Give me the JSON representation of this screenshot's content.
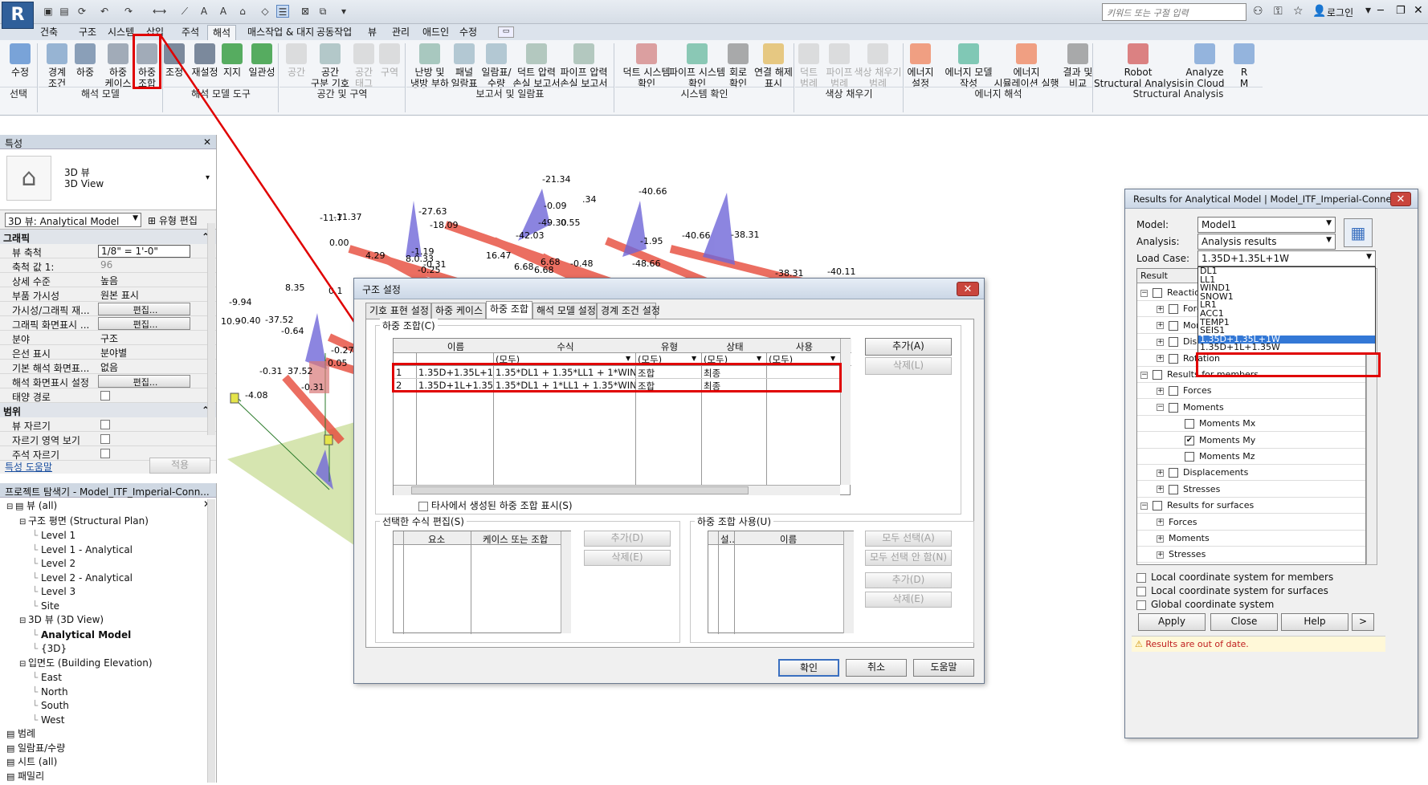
{
  "titlebar": {
    "logo": "R",
    "search_placeholder": "키워드 또는 구절 입력",
    "login": "로그인"
  },
  "ribbon_tabs": [
    "건축",
    "구조",
    "시스템",
    "삽입",
    "주석",
    "해석",
    "매스작업 & 대지",
    "공동작업",
    "뷰",
    "관리",
    "애드인",
    "수정"
  ],
  "active_tab": "해석",
  "ribbon": {
    "buttons": [
      {
        "label1": "수정",
        "label2": "",
        "icon": "modify-icon",
        "color": "#5a8ed0"
      },
      {
        "label1": "경계",
        "label2": "조건",
        "icon": "boundary-conditions-icon",
        "color": "#7fa4c9"
      },
      {
        "label1": "하중",
        "label2": "",
        "icon": "loads-icon",
        "color": "#6f8aa8"
      },
      {
        "label1": "하중",
        "label2": "케이스",
        "icon": "load-cases-icon",
        "color": "#8c98a8"
      },
      {
        "label1": "하중",
        "label2": "조합",
        "icon": "load-combinations-icon",
        "color": "#8c98a8"
      },
      {
        "label1": "조정",
        "label2": "",
        "icon": "adjust-icon",
        "color": "#5c6e84"
      },
      {
        "label1": "재설정",
        "label2": "",
        "icon": "reset-icon",
        "color": "#5c6e84"
      },
      {
        "label1": "지지",
        "label2": "",
        "icon": "supports-icon",
        "color": "#2e9a3a"
      },
      {
        "label1": "일관성",
        "label2": "",
        "icon": "consistency-icon",
        "color": "#2e9a3a"
      }
    ],
    "buttons2": [
      {
        "label1": "공간",
        "label2": "",
        "dis": true
      },
      {
        "label1": "공간",
        "label2": "구분 기호",
        "dis": false
      },
      {
        "label1": "공간",
        "label2": "태그",
        "dis": true
      },
      {
        "label1": "구역",
        "label2": "",
        "dis": true
      },
      {
        "label1": "난방 및",
        "label2": "냉방 부하",
        "dis": false
      },
      {
        "label1": "패널",
        "label2": "일람표",
        "dis": false
      },
      {
        "label1": "일람표/",
        "label2": "수량",
        "dis": false
      },
      {
        "label1": "덕트 압력",
        "label2": "손실 보고서",
        "dis": false
      },
      {
        "label1": "파이프 압력",
        "label2": "손실 보고서",
        "dis": false
      },
      {
        "label1": "덕트 시스템",
        "label2": "확인",
        "dis": false
      },
      {
        "label1": "파이프 시스템",
        "label2": "확인",
        "dis": false
      },
      {
        "label1": "회로",
        "label2": "확인",
        "dis": false
      },
      {
        "label1": "연결 해제",
        "label2": "표시",
        "dis": false
      },
      {
        "label1": "덕트",
        "label2": "범례",
        "dis": true
      },
      {
        "label1": "파이프",
        "label2": "범례",
        "dis": true
      },
      {
        "label1": "색상 채우기",
        "label2": "범례",
        "dis": true
      },
      {
        "label1": "에너지",
        "label2": "설정",
        "dis": false
      },
      {
        "label1": "에너지 모델",
        "label2": "작성",
        "dis": false
      },
      {
        "label1": "에너지",
        "label2": "시뮬레이션 실행",
        "dis": false
      },
      {
        "label1": "결과 및",
        "label2": "비교",
        "dis": false
      },
      {
        "label1": "Robot",
        "label2": "Structural Analysis",
        "dis": false
      },
      {
        "label1": "Analyze",
        "label2": "in Cloud",
        "dis": false
      },
      {
        "label1": "R",
        "label2": "M",
        "dis": false
      }
    ],
    "panels": [
      "선택",
      "해석 모델",
      "해석 모델 도구",
      "공간 및 구역",
      "보고서 및 일람표",
      "시스템 확인",
      "색상 채우기",
      "에너지 해석",
      "Structural Analysis"
    ]
  },
  "properties": {
    "header": "특성",
    "type_name1": "3D 뷰",
    "type_name2": "3D View",
    "instance_selector": "3D 뷰: Analytical Model",
    "edit_type": "유형 편집",
    "section_graphics": "그래픽",
    "rows": [
      {
        "k": "뷰 축척",
        "v": "1/8\" = 1'-0\"",
        "t": "inp"
      },
      {
        "k": "축척 값    1:",
        "v": "96",
        "t": "gray"
      },
      {
        "k": "상세 수준",
        "v": "높음",
        "t": "text"
      },
      {
        "k": "부품 가시성",
        "v": "원본 표시",
        "t": "text"
      },
      {
        "k": "가시성/그래픽 재...",
        "v": "편집...",
        "t": "btn"
      },
      {
        "k": "그래픽 화면표시 ...",
        "v": "편집...",
        "t": "btn"
      },
      {
        "k": "분야",
        "v": "구조",
        "t": "text"
      },
      {
        "k": "은선 표시",
        "v": "분야별",
        "t": "text"
      },
      {
        "k": "기본 해석 화면표...",
        "v": "없음",
        "t": "text"
      },
      {
        "k": "해석 화면표시 설정",
        "v": "편집...",
        "t": "btn"
      },
      {
        "k": "태양 경로",
        "v": "",
        "t": "chk"
      }
    ],
    "section_extents": "범위",
    "rows2": [
      {
        "k": "뷰 자르기",
        "v": "",
        "t": "chk"
      },
      {
        "k": "자르기 영역 보기",
        "v": "",
        "t": "chk"
      },
      {
        "k": "주석 자르기",
        "v": "",
        "t": "chk"
      }
    ],
    "help_link": "특성 도움말",
    "apply": "적용"
  },
  "browser": {
    "header": "프로젝트 탐색기 - Model_ITF_Imperial-Conn...",
    "items": [
      {
        "t": "뷰 (all)",
        "lvl": 0,
        "exp": "-",
        "icon": true
      },
      {
        "t": "구조 평면 (Structural Plan)",
        "lvl": 1,
        "exp": "-"
      },
      {
        "t": "Level 1",
        "lvl": 2
      },
      {
        "t": "Level 1 - Analytical",
        "lvl": 2
      },
      {
        "t": "Level 2",
        "lvl": 2
      },
      {
        "t": "Level 2 - Analytical",
        "lvl": 2
      },
      {
        "t": "Level 3",
        "lvl": 2
      },
      {
        "t": "Site",
        "lvl": 2
      },
      {
        "t": "3D 뷰 (3D View)",
        "lvl": 1,
        "exp": "-"
      },
      {
        "t": "Analytical Model",
        "lvl": 2,
        "bold": true
      },
      {
        "t": "{3D}",
        "lvl": 2
      },
      {
        "t": "입면도 (Building Elevation)",
        "lvl": 1,
        "exp": "-"
      },
      {
        "t": "East",
        "lvl": 2
      },
      {
        "t": "North",
        "lvl": 2
      },
      {
        "t": "South",
        "lvl": 2
      },
      {
        "t": "West",
        "lvl": 2
      },
      {
        "t": "범례",
        "lvl": 0,
        "icon": true
      },
      {
        "t": "일람표/수량",
        "lvl": 0,
        "icon": true
      },
      {
        "t": "시트 (all)",
        "lvl": 0,
        "icon": true
      },
      {
        "t": "패밀리",
        "lvl": 0,
        "icon": true
      }
    ]
  },
  "viewport_labels": [
    "-21.34",
    ".34",
    "-40.66",
    "-0.09",
    "-11.7",
    "-11.37",
    "-27.63",
    "-18.09",
    "-49.30",
    "0.55",
    "-40.66",
    "-38.31",
    "0.00",
    "-42.03",
    "-1.95",
    "4.29",
    "8.0.33",
    "-1.19",
    "16.47",
    "6.68",
    "-0.31",
    "-0.25",
    "6.68",
    "-0.48",
    "-48.66",
    "6.68",
    "8.35",
    "-38.31",
    "-40.11",
    "0.1",
    "-9.94",
    "-37.52",
    "10.9",
    "-0.40",
    "-0.64",
    "-0.27",
    "0.05",
    "-0.31",
    "37.52",
    "-4.08",
    "-0.31"
  ],
  "load_dialog": {
    "title": "구조 설정",
    "tabs": [
      "기호 표현 설정",
      "하중 케이스",
      "하중 조합",
      "해석 모델 설정",
      "경계 조건 설정"
    ],
    "active_tab": "하중 조합",
    "group_title": "하중 조합(C)",
    "columns": [
      "이름",
      "수식",
      "유형",
      "상태",
      "사용"
    ],
    "filters": [
      "(모두)",
      "(모두)",
      "(모두)",
      "(모두)"
    ],
    "rows": [
      {
        "n": "1",
        "name": "1.35D+1.35L+1W",
        "formula": "1.35*DL1 + 1.35*LL1 + 1*WIND1",
        "type": "조합",
        "state": "최종"
      },
      {
        "n": "2",
        "name": "1.35D+1L+1.35W",
        "formula": "1.35*DL1 + 1*LL1 + 1.35*WIND1",
        "type": "조합",
        "state": "최종"
      }
    ],
    "add": "추가(A)",
    "delete": "삭제(L)",
    "show_third_party": "타사에서 생성된 하중 조합 표시(S)",
    "formula_group": "선택한 수식 편집(S)",
    "formula_cols": [
      "요소",
      "케이스 또는 조합"
    ],
    "formula_add": "추가(D)",
    "formula_delete": "삭제(E)",
    "usage_group": "하중 조합 사용(U)",
    "usage_cols": [
      "설...",
      "이름"
    ],
    "select_all": "모두 선택(A)",
    "deselect_all": "모두 선택 안 함(N)",
    "usage_add": "추가(D)",
    "usage_delete": "삭제(E)",
    "ok": "확인",
    "cancel": "취소",
    "help": "도움말"
  },
  "results_panel": {
    "title": "Results for Analytical Model | Model_ITF_Imperial-Connec...",
    "model_label": "Model:",
    "model_value": "Model1",
    "analysis_label": "Analysis:",
    "analysis_value": "Analysis results",
    "loadcase_label": "Load Case:",
    "loadcase_value": "1.35D+1.35L+1W",
    "options": [
      "DL1",
      "LL1",
      "WIND1",
      "SNOW1",
      "LR1",
      "ACC1",
      "TEMP1",
      "SEIS1",
      "1.35D+1.35L+1W",
      "1.35D+1L+1.35W"
    ],
    "selected_option": 8,
    "tree_header": "Result",
    "tree": [
      {
        "t": "Reactions",
        "lvl": 0,
        "exp": "-",
        "chk": ""
      },
      {
        "t": "Forces",
        "lvl": 1,
        "exp": "+",
        "chk": ""
      },
      {
        "t": "Moments",
        "lvl": 1,
        "exp": "+",
        "chk": ""
      },
      {
        "t": "Displacements",
        "lvl": 1,
        "exp": "+",
        "chk": ""
      },
      {
        "t": "Rotation",
        "lvl": 1,
        "exp": "+",
        "chk": ""
      },
      {
        "t": "Results for members",
        "lvl": 0,
        "exp": "-",
        "chk": ""
      },
      {
        "t": "Forces",
        "lvl": 1,
        "exp": "+",
        "chk": ""
      },
      {
        "t": "Moments",
        "lvl": 1,
        "exp": "-",
        "chk": ""
      },
      {
        "t": "Moments Mx",
        "lvl": 2,
        "chk": ""
      },
      {
        "t": "Moments My",
        "lvl": 2,
        "chk": "✔"
      },
      {
        "t": "Moments Mz",
        "lvl": 2,
        "chk": ""
      },
      {
        "t": "Displacements",
        "lvl": 1,
        "exp": "+",
        "chk": ""
      },
      {
        "t": "Stresses",
        "lvl": 1,
        "exp": "+",
        "chk": ""
      },
      {
        "t": "Results for surfaces",
        "lvl": 0,
        "exp": "-",
        "chk": ""
      },
      {
        "t": "Forces",
        "lvl": 1,
        "exp": "+",
        "nochk": true
      },
      {
        "t": "Moments",
        "lvl": 1,
        "exp": "+",
        "nochk": true
      },
      {
        "t": "Stresses",
        "lvl": 1,
        "exp": "+",
        "nochk": true
      },
      {
        "t": "Displacements",
        "lvl": 1,
        "exp": "+",
        "nochk": true
      },
      {
        "t": "Deformation",
        "lvl": 0,
        "exp": "+",
        "nochk": true
      }
    ],
    "checks": [
      "Local coordinate system for members",
      "Local coordinate system for surfaces",
      "Global coordinate system"
    ],
    "apply": "Apply",
    "close": "Close",
    "help": "Help",
    "more": ">",
    "warning": "Results are out of date."
  }
}
